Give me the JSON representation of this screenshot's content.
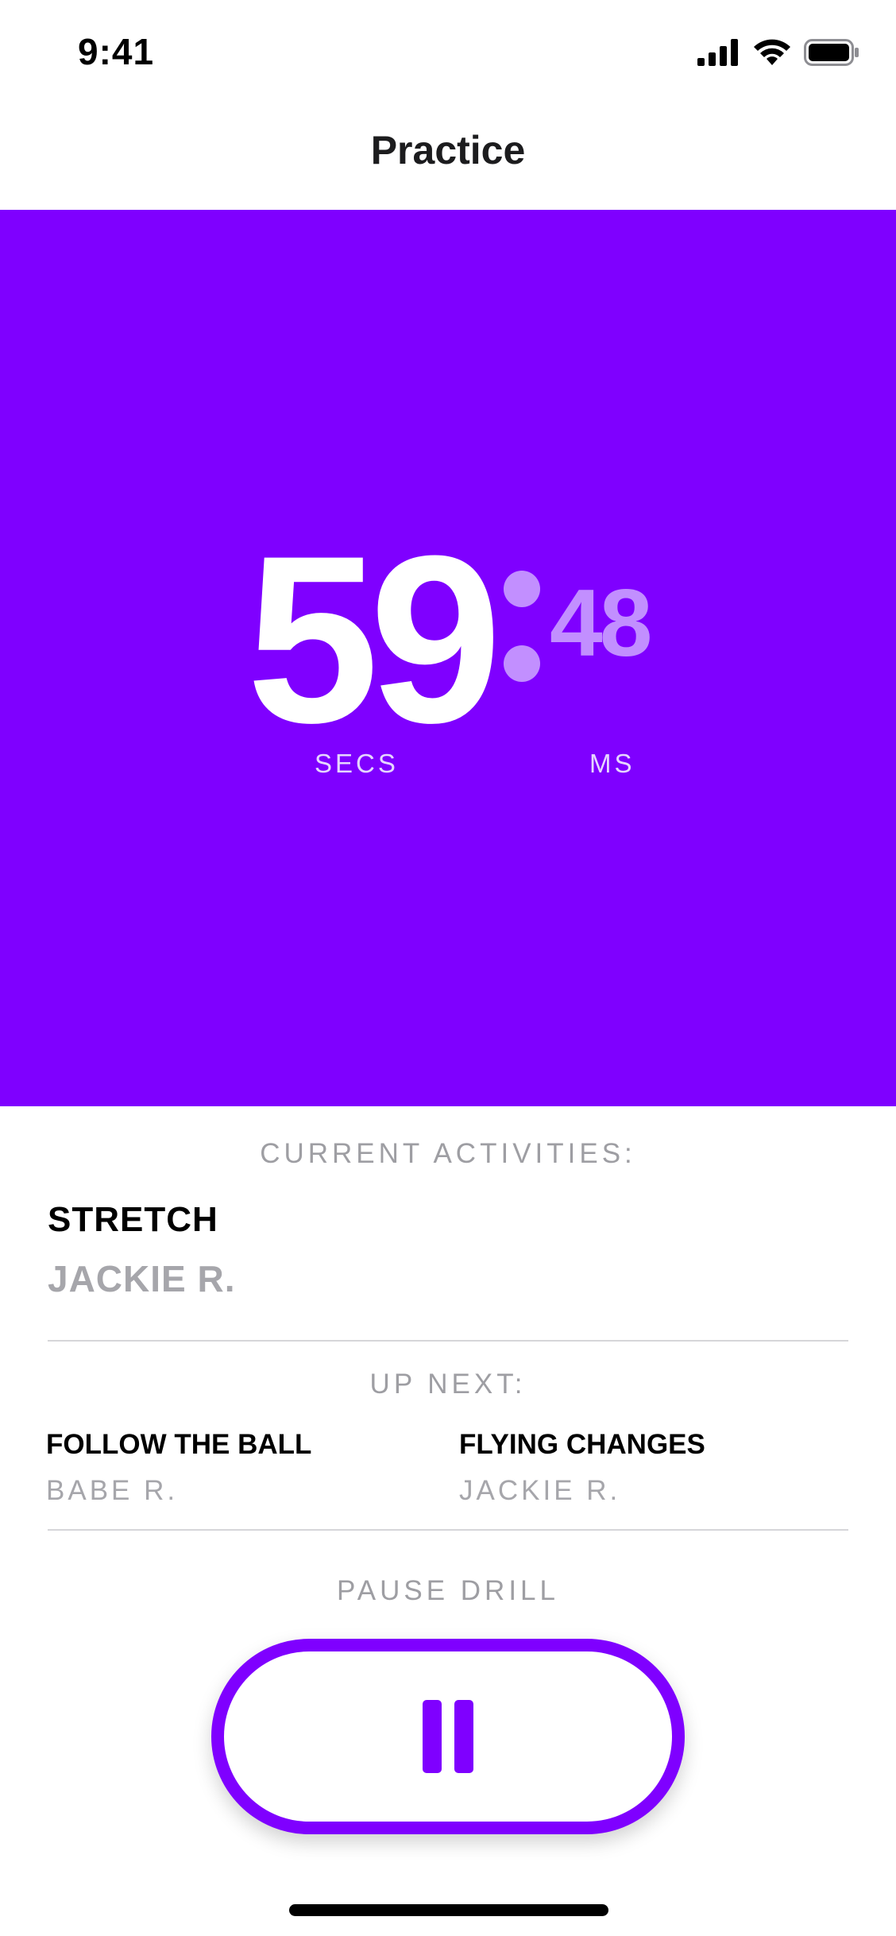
{
  "status_bar": {
    "time": "9:41",
    "icons": [
      "cellular-signal-icon",
      "wifi-icon",
      "battery-icon"
    ]
  },
  "nav": {
    "title": "Practice"
  },
  "timer": {
    "seconds": "59",
    "milliseconds": "48",
    "seconds_label": "SECS",
    "milliseconds_label": "MS"
  },
  "current": {
    "heading": "CURRENT ACTIVITIES:",
    "activity": "STRETCH",
    "person": "JACKIE R."
  },
  "up_next": {
    "heading": "UP NEXT:",
    "items": [
      {
        "title": "FOLLOW THE BALL",
        "person": "BABE R."
      },
      {
        "title": "FLYING CHANGES",
        "person": "JACKIE R."
      }
    ]
  },
  "pause": {
    "label": "PAUSE DRILL",
    "icon": "pause-icon"
  },
  "colors": {
    "accent": "#7f00ff",
    "accent_light": "#c28fff",
    "muted_text": "#a6a6ab"
  }
}
